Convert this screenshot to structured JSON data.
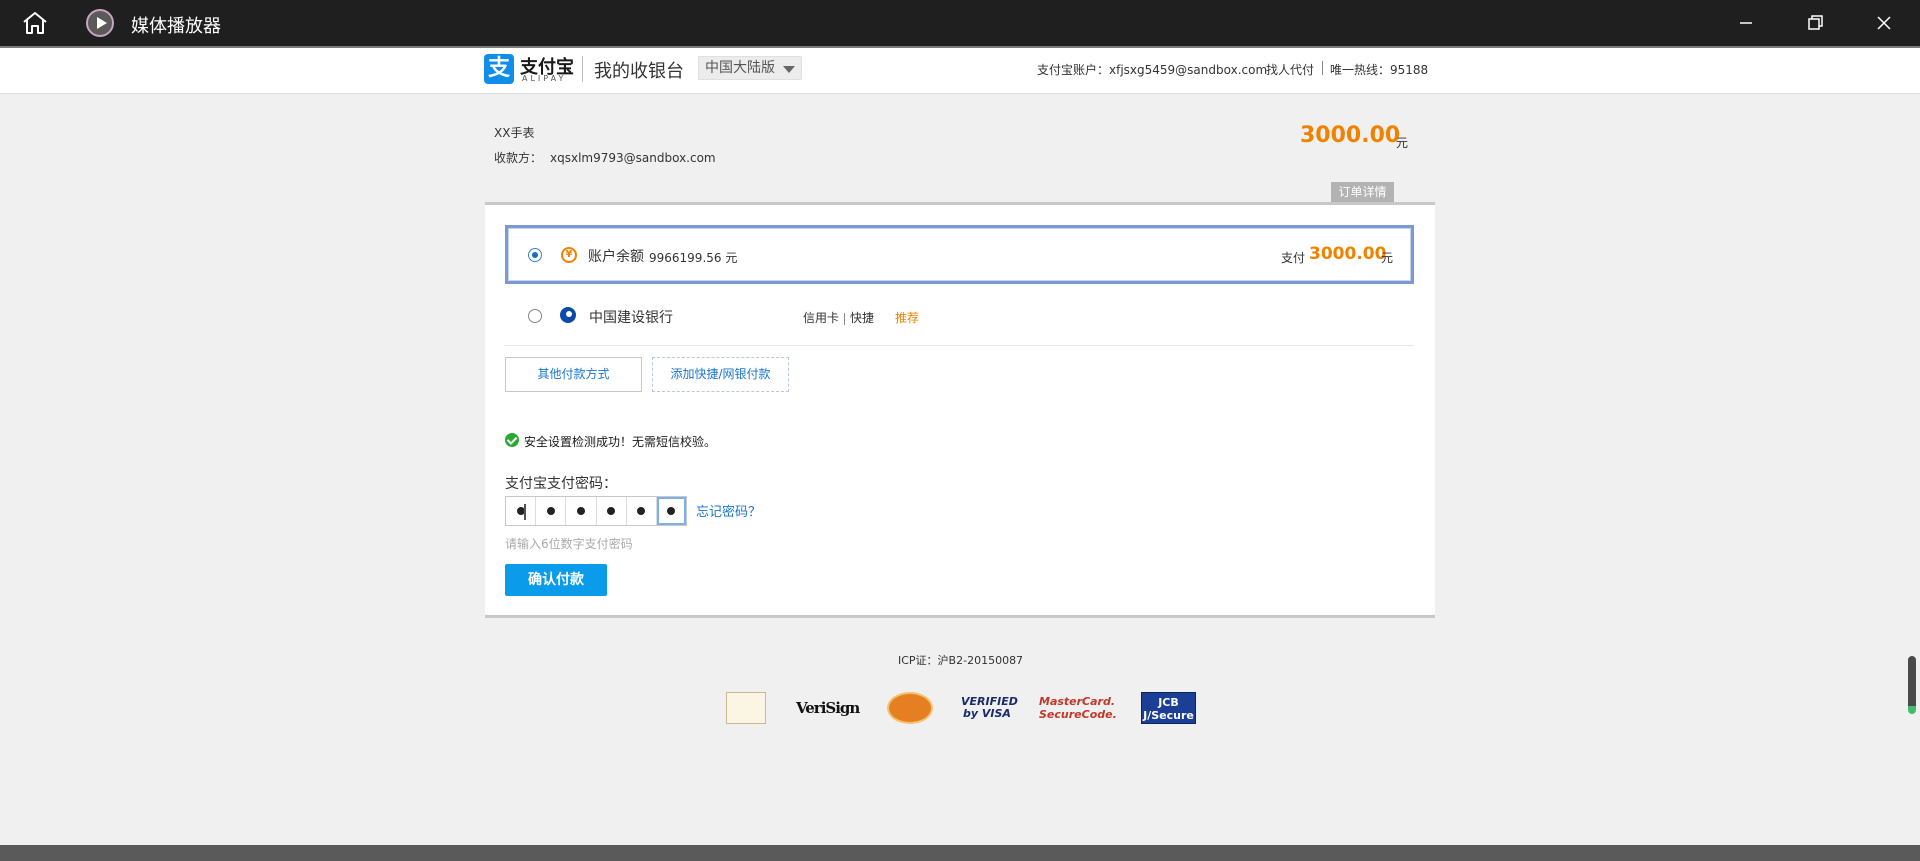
{
  "window": {
    "title": "媒体播放器"
  },
  "header": {
    "logo_cn": "支付宝",
    "logo_en": "ALIPAY",
    "cashier_title": "我的收银台",
    "region": "中国大陆版",
    "account": "支付宝账户：xfjsxg5459@sandbox.com",
    "proxy_pay": "找人代付",
    "hotline": "唯一热线：95188"
  },
  "order": {
    "name": "XX手表",
    "payee_label": "收款方：",
    "payee": "xqsxlm9793@sandbox.com",
    "amount": "3000.00",
    "currency": "元",
    "detail_button": "订单详情"
  },
  "payment_options": {
    "balance": {
      "label": "账户余额",
      "value": "9966199.56 元",
      "pay_label": "支付",
      "pay_amount": "3000.00",
      "pay_currency": "元",
      "selected": true
    },
    "bank": {
      "label": "中国建设银行",
      "tag1": "信用卡",
      "tag2": "快捷",
      "recommend": "推荐",
      "selected": false
    }
  },
  "buttons": {
    "other_methods": "其他付款方式",
    "add_card": "添加快捷/网银付款",
    "confirm": "确认付款"
  },
  "security": {
    "message": "安全设置检测成功！无需短信校验。",
    "password_label": "支付宝支付密码：",
    "forgot": "忘记密码？",
    "hint": "请输入6位数字支付密码",
    "digits_entered": 6
  },
  "footer": {
    "icp": "ICP证：沪B2-20150087",
    "cert_verisign": "VeriSign",
    "cert_visa_line1": "VERIFIED",
    "cert_visa_line2": "by VISA",
    "cert_mc_line1": "MasterCard.",
    "cert_mc_line2": "SecureCode.",
    "cert_jcb_line1": "JCB",
    "cert_jcb_line2": "J/Secure"
  }
}
